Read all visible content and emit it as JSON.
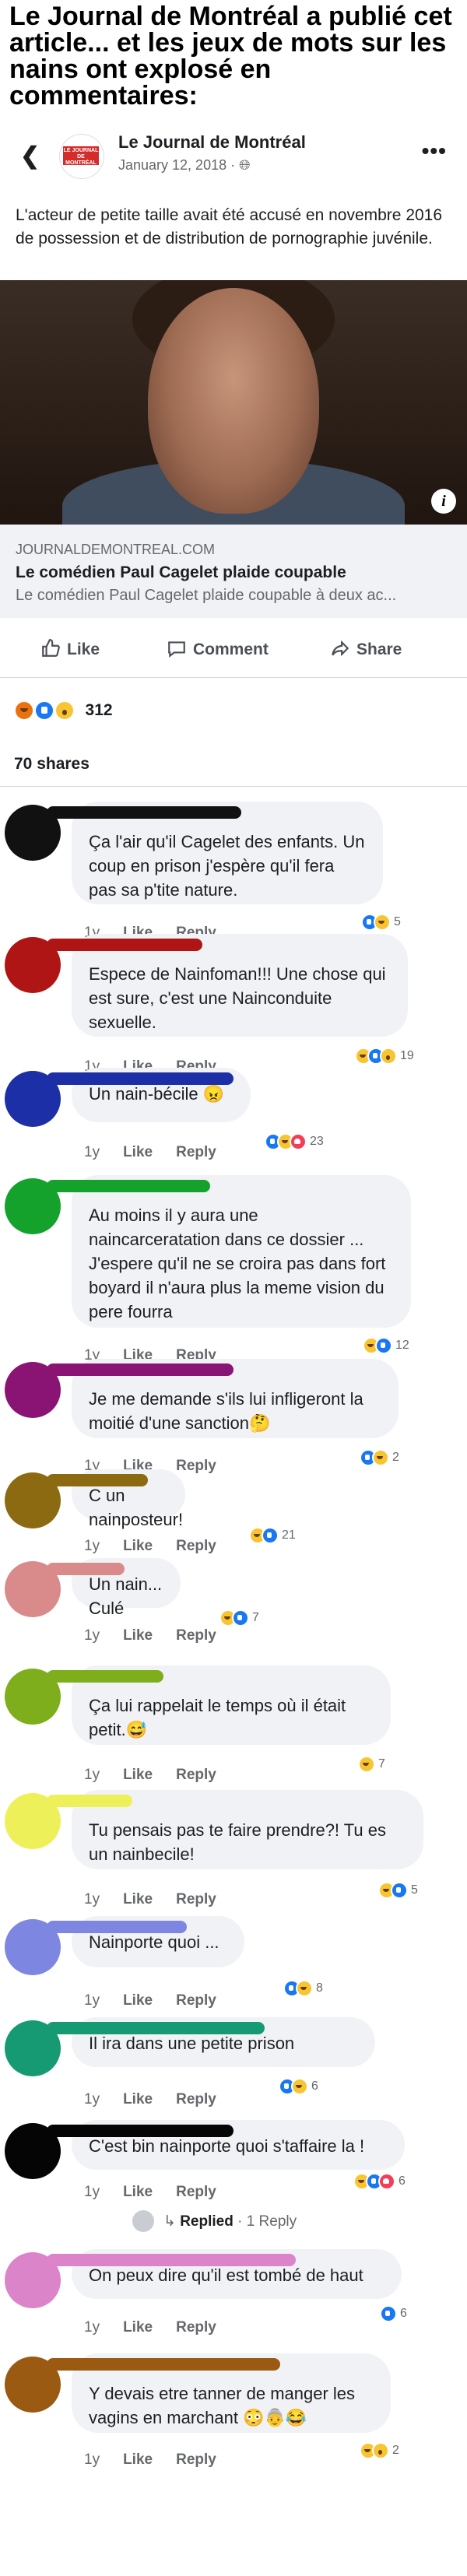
{
  "headline": "Le Journal de Montréal a publié cet article... et les jeux de mots sur les nains ont explosé en commentaires:",
  "post": {
    "page_name": "Le Journal de Montréal",
    "logo_text": "LE JOURNAL DE MONTRÉAL",
    "date": "January 12, 2018 · ",
    "text": "L'acteur de petite taille avait été accusé en novembre 2016 de possession et de distribution de pornographie juvénile.",
    "link_domain": "journaldemontreal.com",
    "link_title": "Le comédien Paul Cagelet plaide coupable",
    "link_desc": "Le comédien Paul Cagelet plaide coupable à deux ac...",
    "info_symbol": "i"
  },
  "actions": {
    "like": "Like",
    "comment": "Comment",
    "share": "Share"
  },
  "summary": {
    "reaction_count": "312",
    "shares": "70 shares"
  },
  "labels": {
    "ago": "1y",
    "like": "Like",
    "reply": "Reply",
    "replied": "Replied",
    "reply_count": " · 1 Reply"
  },
  "colors": {
    "accent": "#1877f2",
    "bubble": "#f0f2f5",
    "muted": "#65676b"
  },
  "comments": [
    {
      "text": "Ça l'air qu'il Cagelet des enfants. Un coup en prison j'espère qu'il fera pas sa p'tite nature.",
      "count": "5",
      "reactions": [
        "like",
        "haha"
      ],
      "scribble_color": "#111111"
    },
    {
      "text": "Espece de Nainfoman!!! Une chose qui est sure, c'est une Nainconduite sexuelle.",
      "count": "19",
      "reactions": [
        "haha",
        "like",
        "wow"
      ],
      "scribble_color": "#b01515"
    },
    {
      "text": "Un nain-bécile 😠",
      "count": "23",
      "reactions": [
        "like",
        "haha",
        "love"
      ],
      "scribble_color": "#1d2fa6"
    },
    {
      "text": "Au moins il y aura une naincarceratation dans ce dossier ... J'espere qu'il ne se croira pas dans fort boyard il n'aura plus la meme vision du pere fourra",
      "count": "12",
      "reactions": [
        "haha",
        "like"
      ],
      "scribble_color": "#14a12c"
    },
    {
      "text": "Je me demande s'ils lui infligeront la moitié d'une sanction🤔",
      "count": "2",
      "reactions": [
        "like",
        "haha"
      ],
      "scribble_color": "#8a1473"
    },
    {
      "text": "C un nainposteur!",
      "count": "21",
      "reactions": [
        "haha",
        "like"
      ],
      "scribble_color": "#8c6a12"
    },
    {
      "text": "Un nain... Culé",
      "count": "7",
      "reactions": [
        "haha",
        "like"
      ],
      "scribble_color": "#d98a8a"
    },
    {
      "text": "Ça lui rappelait le temps où il était petit.😅",
      "count": "7",
      "reactions": [
        "haha"
      ],
      "scribble_color": "#7fae1c"
    },
    {
      "text": "Tu pensais pas te faire prendre?! Tu es un nainbecile!",
      "count": "5",
      "reactions": [
        "haha",
        "like"
      ],
      "scribble_color": "#eef05a"
    },
    {
      "text": "Nainporte  quoi ...",
      "count": "8",
      "reactions": [
        "like",
        "haha"
      ],
      "scribble_color": "#7d86e0"
    },
    {
      "text": "Il ira dans une petite prison",
      "count": "6",
      "reactions": [
        "like",
        "haha"
      ],
      "scribble_color": "#169a73"
    },
    {
      "text": "C'est bin nainporte quoi s'taffaire la !",
      "count": "6",
      "reactions": [
        "haha",
        "like",
        "love"
      ],
      "scribble_color": "#050505"
    },
    {
      "text": "On peux dire qu'il est tombé de haut",
      "count": "6",
      "reactions": [
        "like"
      ],
      "scribble_color": "#db84c9"
    },
    {
      "text": "Y devais etre tanner de manger les vagins en marchant 😳👵😂",
      "count": "2",
      "reactions": [
        "haha",
        "wow"
      ],
      "scribble_color": "#9a5a12"
    }
  ]
}
